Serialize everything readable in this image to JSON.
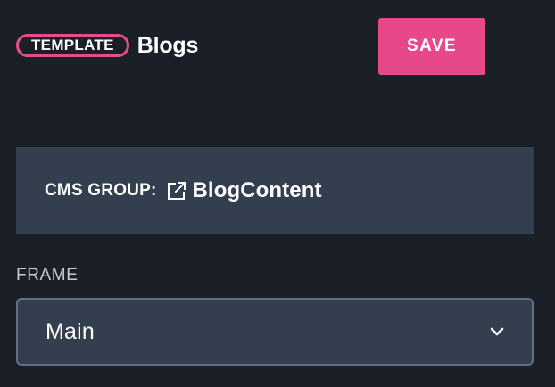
{
  "header": {
    "badge_label": "TEMPLATE",
    "title": "Blogs"
  },
  "toolbar": {
    "save_label": "SAVE"
  },
  "cms_group": {
    "label": "CMS GROUP:",
    "value": "BlogContent",
    "icon": "external-link-icon"
  },
  "frame": {
    "label": "FRAME",
    "selected": "Main",
    "icon": "chevron-down-icon"
  },
  "colors": {
    "background": "#1b1f27",
    "panel": "#333e4e",
    "accent": "#e7488a",
    "border": "#617187",
    "muted_text": "#c5ccd6"
  }
}
